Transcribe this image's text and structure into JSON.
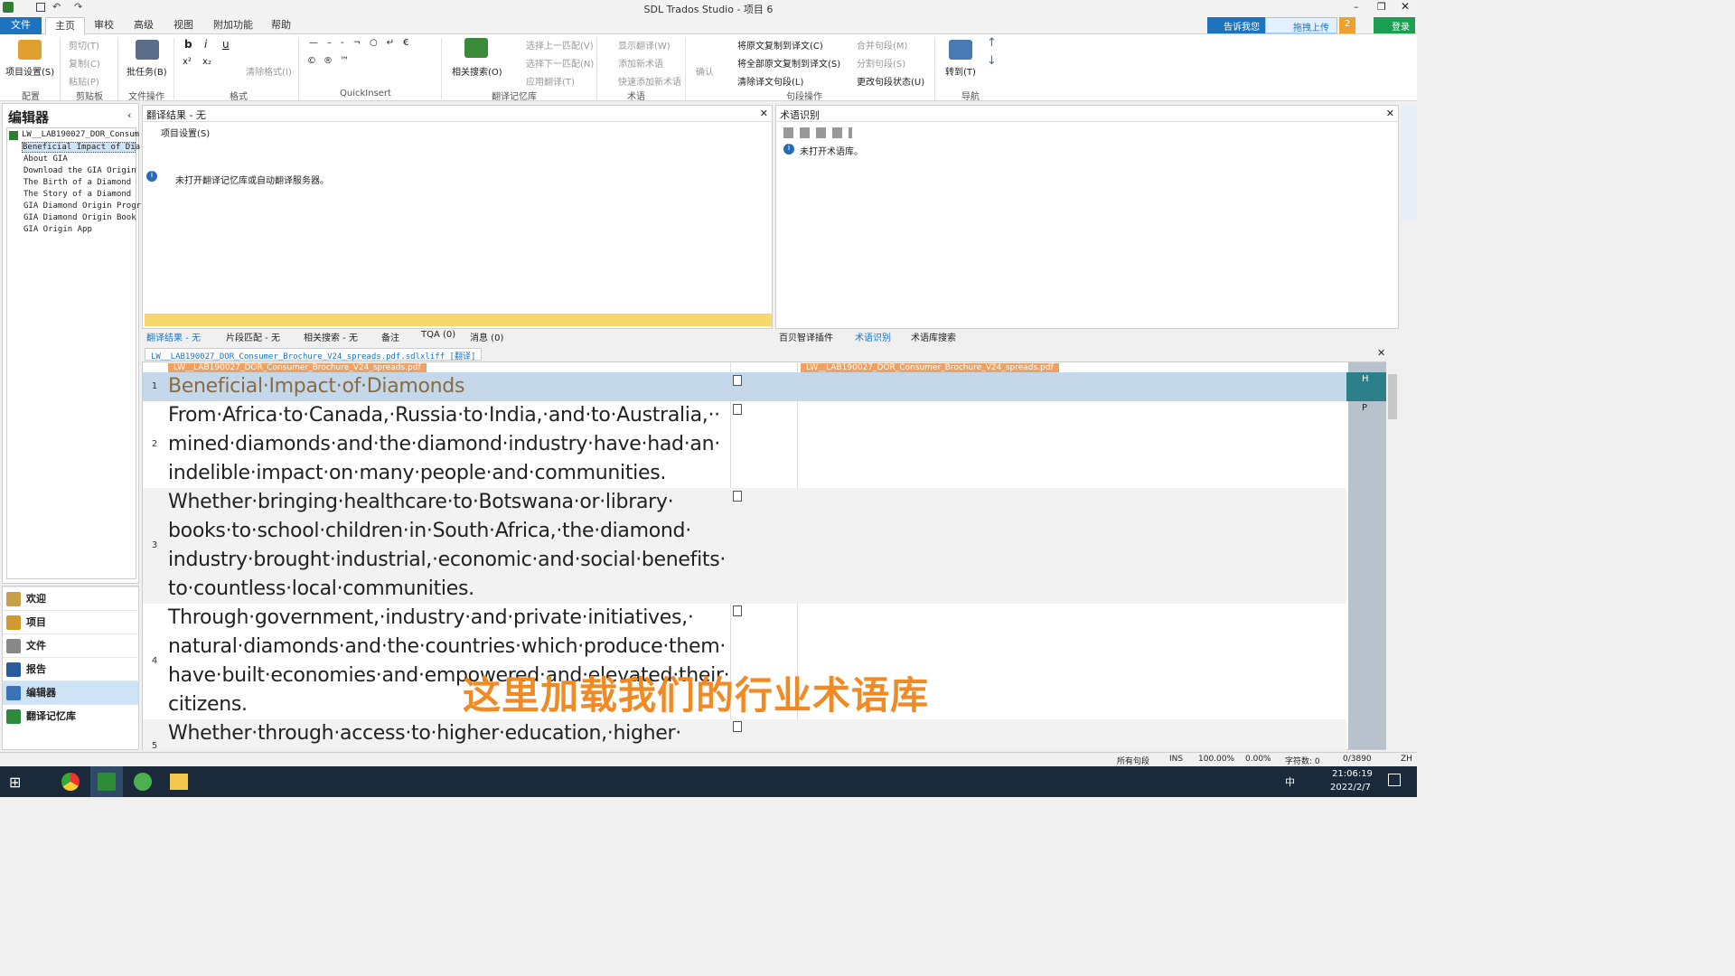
{
  "window": {
    "title": "SDL Trados Studio - 项目 6"
  },
  "tabs": [
    "文件",
    "主页",
    "审校",
    "高级",
    "视图",
    "附加功能",
    "帮助"
  ],
  "topright": {
    "tell_me": "告诉我您",
    "upload": "拖拽上传",
    "badge": "2",
    "login": "登录"
  },
  "ribbon": {
    "project_settings": "项目设置(S)",
    "clipboard": [
      "剪切(T)",
      "复制(C)",
      "粘贴(P)"
    ],
    "batch": "批任务(B)",
    "format_clear": "清除格式(I)",
    "related_search": "相关搜索(O)",
    "tm_ops": [
      "选择上一匹配(V)",
      "选择下一匹配(N)",
      "应用翻译(T)"
    ],
    "term_ops": [
      "显示翻译(W)",
      "添加新术语",
      "快速添加新术语"
    ],
    "confirm": "确认",
    "seg_ops": [
      "将原文复制到译文(C)",
      "将全部原文复制到译文(S)",
      "清除译文句段(L)"
    ],
    "merge": [
      "合并句段(M)",
      "分割句段(S)",
      "更改句段状态(U)"
    ],
    "goto": "转到(T)",
    "groups": [
      "配置",
      "剪贴板",
      "文件操作",
      "格式",
      "QuickInsert",
      "翻译记忆库",
      "术语",
      "句段操作",
      "导航"
    ]
  },
  "editor_panel": {
    "title": "编辑器",
    "tree": [
      "LW__LAB190027_DOR_Consum",
      "Beneficial Impact of Dia",
      "About GIA",
      "Download the GIA Origin",
      "The Birth of a Diamond",
      "The Story of a Diamond",
      "GIA Diamond Origin Progr",
      "GIA Diamond Origin Book",
      "GIA Origin App"
    ],
    "nav": [
      "欢迎",
      "项目",
      "文件",
      "报告",
      "编辑器",
      "翻译记忆库"
    ]
  },
  "tm_panel": {
    "title": "翻译结果 - 无",
    "toolbar_label": "项目设置(S)",
    "message": "未打开翻译记忆库或自动翻译服务器。"
  },
  "term_panel": {
    "title": "术语识别",
    "message": "未打开术语库。"
  },
  "bottom_tabs_left": [
    "翻译结果 - 无",
    "片段匹配 - 无",
    "相关搜索 - 无",
    "备注",
    "TQA (0)",
    "消息 (0)"
  ],
  "bottom_tabs_right": [
    "百贝智译插件",
    "术语识别",
    "术语库搜索"
  ],
  "doc_tab": "LW__LAB190027_DOR_Consumer_Brochure_V24_spreads.pdf.sdlxliff [翻译]",
  "src_tag": "LW__LAB190027_DOR_Consumer_Brochure_V24_spreads.pdf",
  "tgt_tag": "LW__LAB190027_DOR_Consumer_Brochure_V24_spreads.pdf",
  "segments": [
    {
      "num": "1",
      "text": "Beneficial·Impact·of·Diamonds",
      "status": "H"
    },
    {
      "num": "2",
      "text": "From·Africa·to·Canada,·Russia·to·India,·and·to·Australia,·· mined·diamonds·and·the·diamond·industry·have·had·an· indelible·impact·on·many·people·and·communities.",
      "status": "P"
    },
    {
      "num": "3",
      "text": "Whether·bringing·healthcare·to·Botswana·or·library· books·to·school·children·in·South·Africa,·the·diamond· industry·brought·industrial,·economic·and·social·benefits· to·countless·local·communities.",
      "status": ""
    },
    {
      "num": "4",
      "text": "Through·government,·industry·and·private·initiatives,· natural·diamonds·and·the·countries·which·produce·them· have·built·economies·and·empowered·and·elevated·their· citizens.",
      "status": ""
    },
    {
      "num": "5",
      "text": "Whether·through·access·to·higher·education,·higher·",
      "status": ""
    }
  ],
  "subtitle": "这里加载我们的行业术语库",
  "statusbar": {
    "filter": "所有句段",
    "ins": "INS",
    "pct1": "100.00%",
    "pct2": "0.00%",
    "chars": "字符数: 0",
    "count": "0/3890",
    "lang": "ZH"
  },
  "clock": {
    "time": "21:06:19",
    "date": "2022/2/7"
  },
  "tray": {
    "ime": "中"
  }
}
